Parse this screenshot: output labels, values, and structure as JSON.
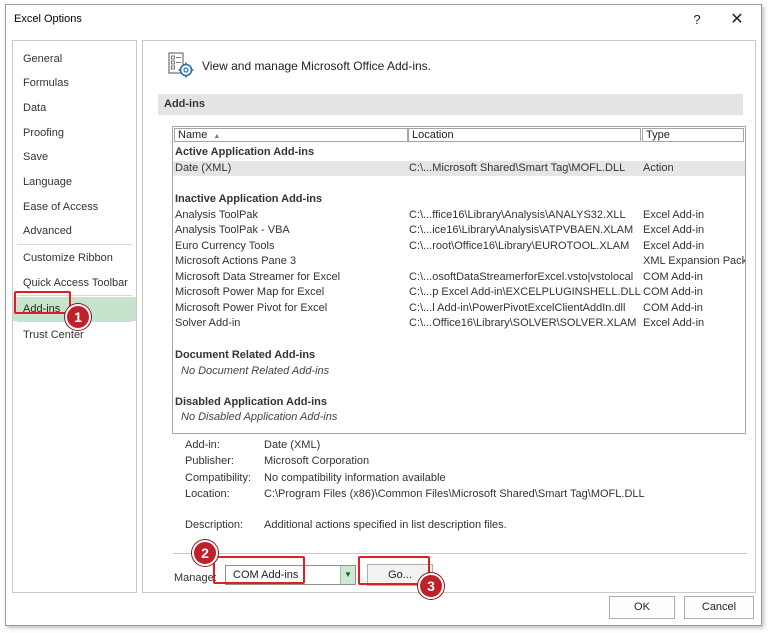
{
  "window": {
    "title": "Excel Options",
    "help_glyph": "?",
    "close_glyph": "✕"
  },
  "nav": {
    "items": [
      {
        "label": "General"
      },
      {
        "label": "Formulas"
      },
      {
        "label": "Data"
      },
      {
        "label": "Proofing"
      },
      {
        "label": "Save"
      },
      {
        "label": "Language"
      },
      {
        "label": "Ease of Access"
      },
      {
        "label": "Advanced"
      },
      {
        "label": "Customize Ribbon"
      },
      {
        "label": "Quick Access Toolbar"
      },
      {
        "label": "Add-ins",
        "selected": true
      },
      {
        "label": "Trust Center"
      }
    ]
  },
  "header": {
    "text": "View and manage Microsoft Office Add-ins.",
    "icon": "addins-gear-icon"
  },
  "section_title": "Add-ins",
  "table": {
    "columns": {
      "name": "Name",
      "sort_glyph": "▲",
      "location": "Location",
      "type": "Type"
    },
    "active": {
      "title": "Active Application Add-ins",
      "rows": [
        {
          "name": "Date (XML)",
          "location": "C:\\...Microsoft Shared\\Smart Tag\\MOFL.DLL",
          "type": "Action"
        }
      ]
    },
    "inactive": {
      "title": "Inactive Application Add-ins",
      "rows": [
        {
          "name": "Analysis ToolPak",
          "location": "C:\\...ffice16\\Library\\Analysis\\ANALYS32.XLL",
          "type": "Excel Add-in"
        },
        {
          "name": "Analysis ToolPak - VBA",
          "location": "C:\\...ice16\\Library\\Analysis\\ATPVBAEN.XLAM",
          "type": "Excel Add-in"
        },
        {
          "name": "Euro Currency Tools",
          "location": "C:\\...root\\Office16\\Library\\EUROTOOL.XLAM",
          "type": "Excel Add-in"
        },
        {
          "name": "Microsoft Actions Pane 3",
          "location": "",
          "type": "XML Expansion Pack"
        },
        {
          "name": "Microsoft Data Streamer for Excel",
          "location": "C:\\...osoftDataStreamerforExcel.vsto|vstolocal",
          "type": "COM Add-in"
        },
        {
          "name": "Microsoft Power Map for Excel",
          "location": "C:\\...p Excel Add-in\\EXCELPLUGINSHELL.DLL",
          "type": "COM Add-in"
        },
        {
          "name": "Microsoft Power Pivot for Excel",
          "location": "C:\\...l Add-in\\PowerPivotExcelClientAddIn.dll",
          "type": "COM Add-in"
        },
        {
          "name": "Solver Add-in",
          "location": "C:\\...Office16\\Library\\SOLVER\\SOLVER.XLAM",
          "type": "Excel Add-in"
        }
      ]
    },
    "document": {
      "title": "Document Related Add-ins",
      "empty": "No Document Related Add-ins"
    },
    "disabled": {
      "title": "Disabled Application Add-ins",
      "empty": "No Disabled Application Add-ins"
    }
  },
  "details": {
    "addin_label": "Add-in:",
    "addin_value": "Date (XML)",
    "publisher_label": "Publisher:",
    "publisher_value": "Microsoft Corporation",
    "compat_label": "Compatibility:",
    "compat_value": "No compatibility information available",
    "location_label": "Location:",
    "location_value": "C:\\Program Files (x86)\\Common Files\\Microsoft Shared\\Smart Tag\\MOFL.DLL",
    "desc_label": "Description:",
    "desc_value": "Additional actions specified in list description files."
  },
  "manage": {
    "label": "Manage:",
    "selected": "COM Add-ins",
    "go_label": "Go..."
  },
  "buttons": {
    "ok": "OK",
    "cancel": "Cancel"
  },
  "callouts": [
    "1",
    "2",
    "3"
  ],
  "colors": {
    "highlight": "#e02020",
    "selected_nav": "#c6e3cd",
    "badge": "#c0202a"
  }
}
